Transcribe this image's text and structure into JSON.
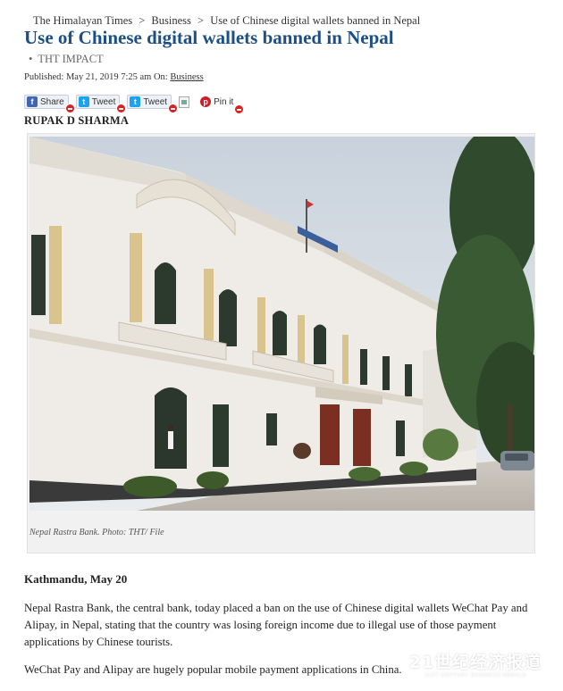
{
  "breadcrumb": {
    "items": [
      "The Himalayan Times",
      "Business",
      "Use of Chinese digital wallets banned in Nepal"
    ],
    "separator": ">"
  },
  "article": {
    "title": "Use of Chinese digital wallets banned in Nepal",
    "impact_label": "THT IMPACT",
    "published_prefix": "Published: May 21, 2019 7:25 am On: ",
    "category_link": "Business",
    "author": "RUPAK D SHARMA",
    "caption": "Nepal Rastra Bank. Photo: THT/ File",
    "dateline": "Kathmandu, May 20",
    "paragraphs": [
      "Nepal Rastra Bank, the central bank, today placed a ban on the use of Chinese digital wallets WeChat Pay and Alipay, in Nepal, stating that the country was losing foreign income due to illegal use of those payment applications by Chinese tourists.",
      "WeChat Pay and Alipay are hugely popular mobile payment applications in China."
    ]
  },
  "share": {
    "facebook_label": "Share",
    "tweet_label_1": "Tweet",
    "tweet_label_2": "Tweet",
    "pin_label": "Pin it",
    "icons": [
      "facebook-icon",
      "twitter-icon",
      "twitter-icon",
      "broken-image-icon",
      "pinterest-icon"
    ]
  },
  "watermark": {
    "text": "21世纪经济报道",
    "subtext": "21ST CENTURY BUSINESS HERALD"
  },
  "colors": {
    "title": "#1b4f86",
    "facebook": "#4267b2",
    "twitter": "#1da1f2",
    "pinterest": "#cb2027",
    "badge": "#d92121"
  }
}
